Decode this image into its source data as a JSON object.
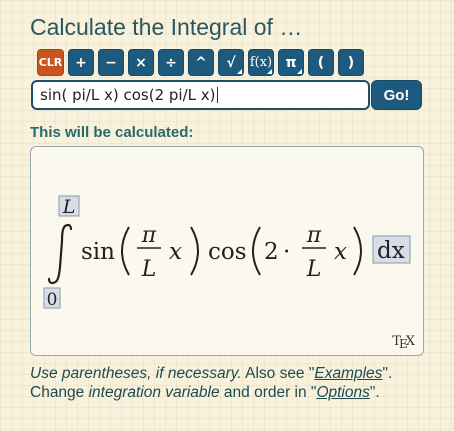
{
  "title": "Calculate the Integral of …",
  "toolbar": {
    "keys": [
      {
        "label": "CLR",
        "name": "clear-button",
        "tri": false
      },
      {
        "label": "+",
        "name": "plus-button",
        "tri": false
      },
      {
        "label": "−",
        "name": "minus-button",
        "tri": false
      },
      {
        "label": "×",
        "name": "multiply-button",
        "tri": false
      },
      {
        "label": "÷",
        "name": "divide-button",
        "tri": false
      },
      {
        "label": "^",
        "name": "power-button",
        "tri": false
      },
      {
        "label": "√",
        "name": "sqrt-button",
        "tri": true
      },
      {
        "label": "f(x)",
        "name": "function-button",
        "tri": true
      },
      {
        "label": "π",
        "name": "pi-button",
        "tri": true
      },
      {
        "label": "(",
        "name": "open-paren-button",
        "tri": false
      },
      {
        "label": ")",
        "name": "close-paren-button",
        "tri": false
      }
    ]
  },
  "input": {
    "value": "sin( pi/L x) cos(2 pi/L x)"
  },
  "go_label": "Go!",
  "calc_label": "This will be calculated:",
  "formula": {
    "upper": "L",
    "lower": "0",
    "sin": "sin",
    "cos": "cos",
    "pi": "π",
    "L": "L",
    "x": "x",
    "two": "2",
    "dot": "·",
    "dx": "dx"
  },
  "tex_badge": {
    "t": "T",
    "e": "E",
    "x": "X"
  },
  "hint": {
    "line1_a": "Use parentheses, if necessary.",
    "line1_b": " Also see \"",
    "line1_link": "Examples",
    "line1_c": "\".",
    "line2_a": "Change ",
    "line2_b": "integration variable",
    "line2_c": " and order in \"",
    "line2_link": "Options",
    "line2_d": "\"."
  }
}
